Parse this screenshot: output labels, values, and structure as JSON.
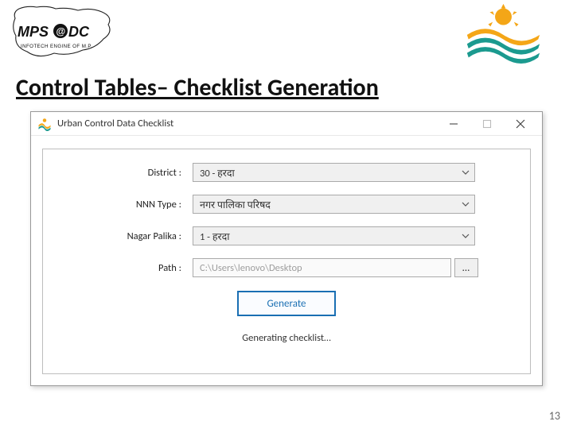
{
  "slide": {
    "title": "Control Tables– Checklist Generation",
    "page_number": "13"
  },
  "logos": {
    "left_brand_main": "MPS@DC",
    "left_brand_sub": "INFOTECH ENGINE OF M.P."
  },
  "window": {
    "title": "Urban Control Data Checklist",
    "controls": {
      "minimize": "minimize-icon",
      "maximize": "maximize-icon",
      "close": "close-icon"
    },
    "fields": {
      "district": {
        "label": "District :",
        "value": "30 - हरदा"
      },
      "nnn_type": {
        "label": "NNN Type :",
        "value": "नगर पालिका परिषद"
      },
      "nagar_palika": {
        "label": "Nagar Palika :",
        "value": "1 - हरदा"
      },
      "path": {
        "label": "Path :",
        "value": "C:\\Users\\lenovo\\Desktop",
        "browse_label": "…"
      }
    },
    "generate_label": "Generate",
    "status": "Generating checklist…"
  }
}
